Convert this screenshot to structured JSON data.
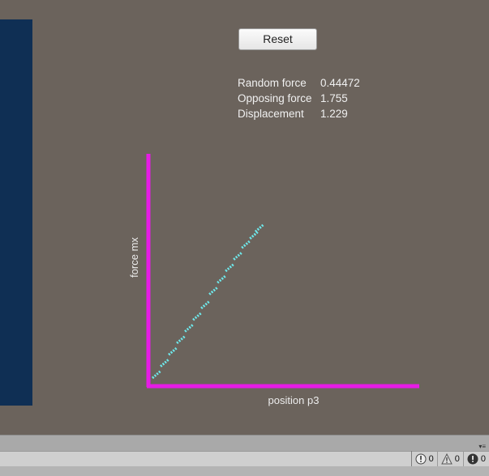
{
  "controls": {
    "reset_label": "Reset"
  },
  "readouts": [
    {
      "label": "Random force",
      "value": "0.44472"
    },
    {
      "label": "Opposing force",
      "value": "1.755"
    },
    {
      "label": "Displacement",
      "value": "1.229"
    }
  ],
  "chart_data": {
    "type": "scatter",
    "xlabel": "position p3",
    "ylabel": "force mx",
    "xlim": [
      0,
      1
    ],
    "ylim": [
      0,
      1
    ],
    "grid": false,
    "legend": "none",
    "series": [
      {
        "x": [
          0.03,
          0.06,
          0.09,
          0.12,
          0.15,
          0.18,
          0.21,
          0.24,
          0.27,
          0.3,
          0.33,
          0.36,
          0.39,
          0.41
        ],
        "y": [
          0.05,
          0.1,
          0.15,
          0.2,
          0.25,
          0.3,
          0.35,
          0.41,
          0.46,
          0.51,
          0.56,
          0.61,
          0.65,
          0.68
        ]
      }
    ]
  },
  "colors": {
    "axis": "#e61be6",
    "points": "#6ee9ec",
    "background": "#6b635c",
    "left_panel": "#0f2f54"
  },
  "status_bar": {
    "info_icon": "info-circle-icon",
    "info_count": "0",
    "warning_icon": "warning-triangle-icon",
    "warning_count": "0",
    "error_icon": "error-circle-icon",
    "error_count": "0"
  }
}
